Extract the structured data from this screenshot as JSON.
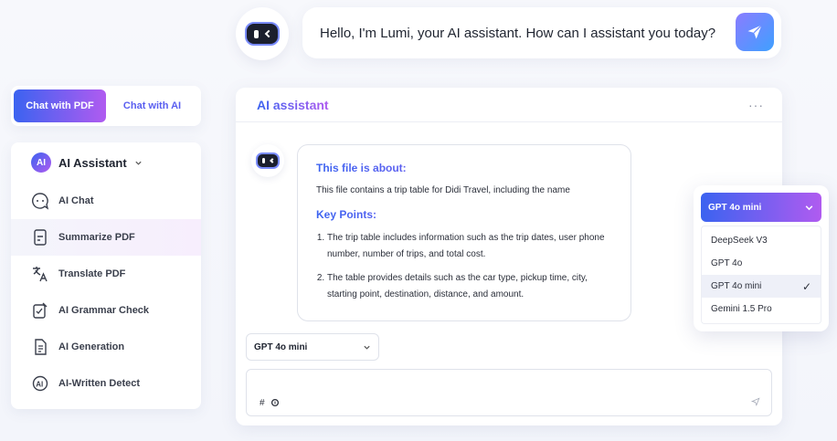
{
  "greeting": {
    "text": "Hello, I'm Lumi, your AI assistant. How can I assistant you today?"
  },
  "tabs": [
    {
      "label": "Chat with PDF",
      "active": true
    },
    {
      "label": "Chat with AI",
      "active": false
    }
  ],
  "sidebar": {
    "header": "AI Assistant",
    "items": [
      {
        "label": "AI Chat",
        "icon": "chat-bubble-icon"
      },
      {
        "label": "Summarize PDF",
        "icon": "document-summary-icon",
        "active": true
      },
      {
        "label": "Translate PDF",
        "icon": "translate-icon"
      },
      {
        "label": "AI Grammar Check",
        "icon": "grammar-check-icon"
      },
      {
        "label": "AI Generation",
        "icon": "document-generate-icon"
      },
      {
        "label": "AI-Written Detect",
        "icon": "ai-detect-icon"
      }
    ]
  },
  "panel": {
    "title": "AI assistant",
    "menu": "···"
  },
  "message": {
    "heading": "This file is about:",
    "summary": "This file contains a trip table for Didi Travel, including the name",
    "points_heading": "Key Points:",
    "points": [
      "The trip table includes information such as the trip dates, user phone number, number of trips, and total cost.",
      "The table provides details such as the car type, pickup time, city, starting point, destination, distance, and amount."
    ]
  },
  "model_select": {
    "value": "GPT 4o mini"
  },
  "input": {
    "tool_hash": "#",
    "tool_attach": "⌕"
  },
  "dropdown": {
    "selected": "GPT 4o mini",
    "options": [
      "DeepSeek V3",
      "GPT 4o",
      "GPT 4o mini",
      "Gemini 1.5 Pro"
    ],
    "check": "✓"
  },
  "colors": {
    "accent_start": "#3b63f0",
    "accent_end": "#b05bf0"
  }
}
